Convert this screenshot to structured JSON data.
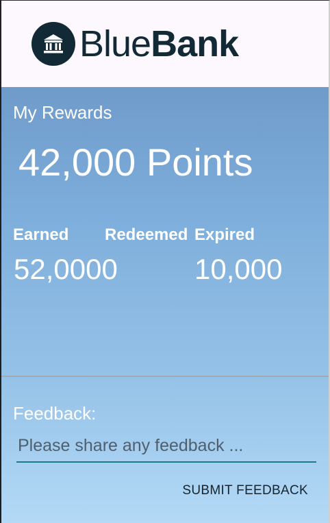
{
  "brand": {
    "name_light": "Blue",
    "name_bold": "Bank",
    "icon": "bank-icon",
    "color": "#112a36"
  },
  "rewards": {
    "title": "My Rewards",
    "points": "42,000 Points",
    "stats": {
      "earned_label": "Earned",
      "redeemed_label": "Redeemed",
      "expired_label": "Expired",
      "earned_value": "52,0000",
      "expired_value": "10,000"
    }
  },
  "feedback": {
    "label": "Feedback:",
    "placeholder": "Please share any feedback ...",
    "submit_label": "SUBMIT FEEDBACK",
    "accent_color": "#1c7c86"
  }
}
